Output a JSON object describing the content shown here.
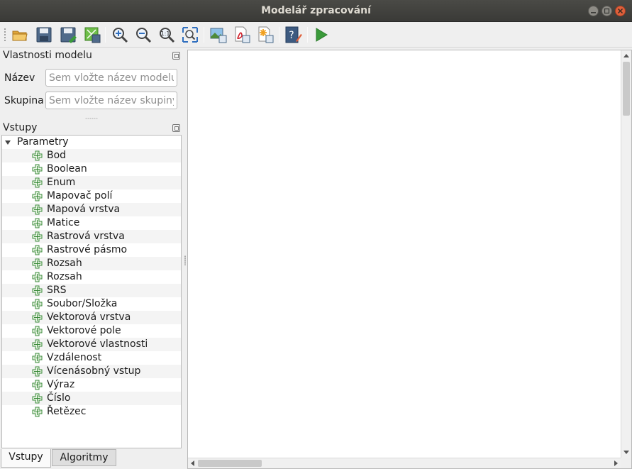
{
  "window": {
    "title": "Modelář zpracování"
  },
  "toolbar": {
    "buttons": [
      {
        "icon": "open-folder-icon"
      },
      {
        "icon": "save-icon"
      },
      {
        "icon": "save-as-icon"
      },
      {
        "icon": "save-to-project-icon"
      },
      {
        "icon": "zoom-in-icon"
      },
      {
        "icon": "zoom-out-icon"
      },
      {
        "icon": "zoom-actual-icon",
        "text": "1:1"
      },
      {
        "icon": "zoom-full-icon"
      },
      {
        "icon": "export-image-icon"
      },
      {
        "icon": "export-pdf-icon"
      },
      {
        "icon": "export-svg-icon"
      },
      {
        "icon": "edit-help-icon"
      },
      {
        "icon": "run-icon"
      }
    ]
  },
  "model_properties": {
    "title": "Vlastnosti modelu",
    "name_label": "Název",
    "name_placeholder": "Sem vložte název modelu",
    "group_label": "Skupina",
    "group_placeholder": "Sem vložte název skupiny"
  },
  "inputs": {
    "title": "Vstupy",
    "root": "Parametry",
    "items": [
      "Bod",
      "Boolean",
      "Enum",
      "Mapovač polí",
      "Mapová vrstva",
      "Matice",
      "Rastrová vrstva",
      "Rastrové pásmo",
      "Rozsah",
      "Rozsah",
      "SRS",
      "Soubor/Složka",
      "Vektorová vrstva",
      "Vektorové pole",
      "Vektorové vlastnosti",
      "Vzdálenost",
      "Vícenásobný vstup",
      "Výraz",
      "Číslo",
      "Řetězec"
    ]
  },
  "tabs": {
    "inputs": "Vstupy",
    "algorithms": "Algoritmy"
  },
  "colors": {
    "titlebar": "#3c3b37",
    "close": "#e0603b",
    "accent_green": "#3a9a3a"
  }
}
